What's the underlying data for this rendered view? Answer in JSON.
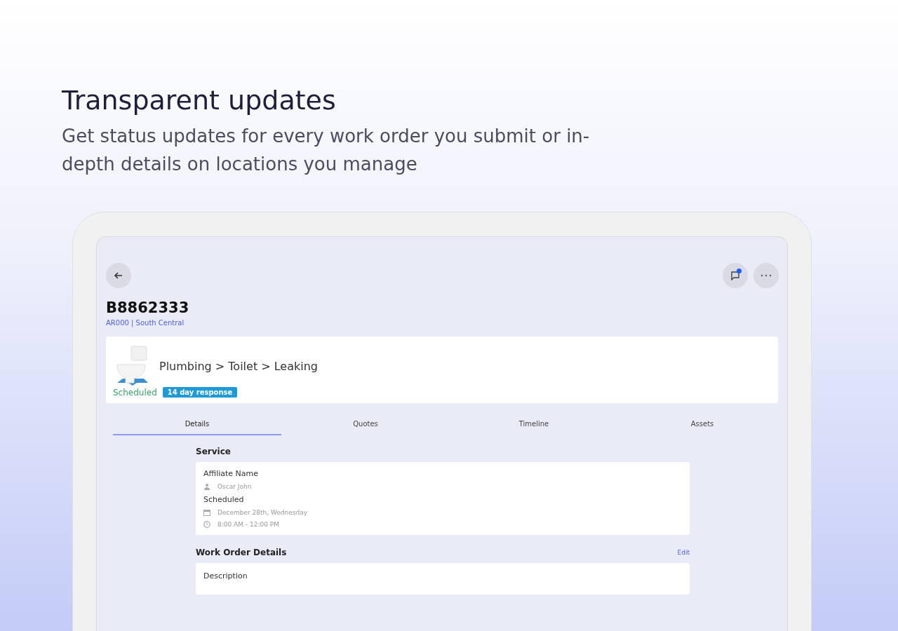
{
  "headline": "Transparent updates",
  "subtitle": "Get status updates for every work order you submit or in-depth details on locations you manage",
  "header": {
    "chat_unread": true
  },
  "work_order": {
    "number": "B8862333",
    "location": "AR000 | South Central",
    "category": "Plumbing > Toilet > Leaking",
    "status": "Scheduled",
    "response_badge": "14 day response"
  },
  "tabs": [
    {
      "label": "Details",
      "selected": true
    },
    {
      "label": "Quotes",
      "selected": false
    },
    {
      "label": "Timeline",
      "selected": false
    },
    {
      "label": "Assets",
      "selected": false
    }
  ],
  "service": {
    "title": "Service",
    "affiliate_label": "Affiliate Name",
    "affiliate_name": "Oscar John",
    "scheduled_label": "Scheduled",
    "date": "December 28th, Wednesday",
    "time": "8:00 AM - 12:00 PM"
  },
  "work_order_details": {
    "title": "Work Order Details",
    "edit": "Edit",
    "description_label": "Description"
  }
}
